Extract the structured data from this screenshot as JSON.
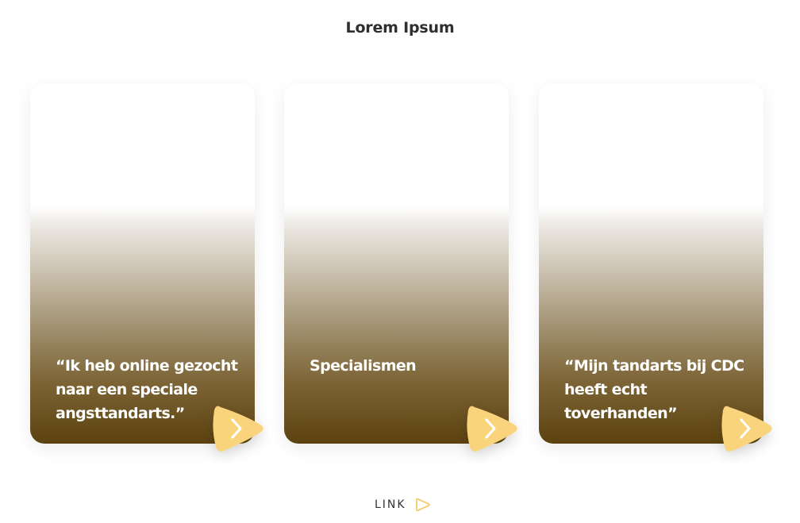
{
  "header": {
    "title": "Lorem Ipsum"
  },
  "cards": [
    {
      "text": "“Ik heb online gezocht naar een speciale angsttandarts.”"
    },
    {
      "text": "Specialismen"
    },
    {
      "text": "“Mijn tandarts bij CDC heeft echt toverhanden”"
    }
  ],
  "footer": {
    "link_label": "LINK"
  },
  "colors": {
    "accent": "#f9d47c",
    "gradient_bottom": "#5c420f",
    "title": "#2f2f2f"
  },
  "icons": {
    "card_arrow": "chevron-right-icon",
    "link_arrow": "play-triangle-icon"
  }
}
